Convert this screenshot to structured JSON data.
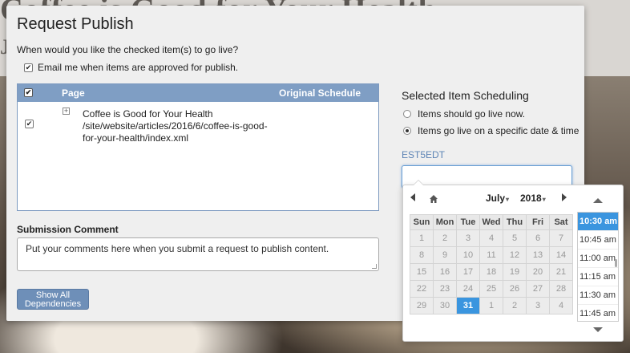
{
  "background": {
    "headline": "Coffee is Good for Your Health",
    "byline_initial": "J"
  },
  "dialog": {
    "title": "Request Publish",
    "prompt": "When would you like the checked item(s) to go live?",
    "email_label": "Email me when items are approved for publish.",
    "table": {
      "col_page": "Page",
      "col_schedule": "Original Schedule",
      "rows": [
        {
          "checked": true,
          "title": "Coffee is Good for Your Health",
          "path": "/site/website/articles/2016/6/coffee-is-good-for-your-health/index.xml",
          "schedule": ""
        }
      ]
    },
    "submission": {
      "label": "Submission Comment",
      "placeholder": "Put your comments here when you submit a request to publish content."
    },
    "dependencies_button": "Show All Dependencies",
    "scheduling": {
      "title": "Selected Item Scheduling",
      "option_now": "Items should go live now.",
      "option_specific": "Items go live on a specific date & time",
      "selected_option": "specific",
      "timezone": "EST5EDT",
      "datetime_value": ""
    },
    "picker": {
      "month": "July",
      "year": "2018",
      "weekdays": [
        "Sun",
        "Mon",
        "Tue",
        "Wed",
        "Thu",
        "Fri",
        "Sat"
      ],
      "weeks": [
        [
          "1",
          "2",
          "3",
          "4",
          "5",
          "6",
          "7"
        ],
        [
          "8",
          "9",
          "10",
          "11",
          "12",
          "13",
          "14"
        ],
        [
          "15",
          "16",
          "17",
          "18",
          "19",
          "20",
          "21"
        ],
        [
          "22",
          "23",
          "24",
          "25",
          "26",
          "27",
          "28"
        ],
        [
          "29",
          "30",
          "31",
          "1",
          "2",
          "3",
          "4"
        ]
      ],
      "selected_day": "31",
      "times": [
        "10:30 am",
        "10:45 am",
        "11:00 am",
        "11:15 am",
        "11:30 am",
        "11:45 am"
      ],
      "selected_time": "10:30 am"
    }
  },
  "colors": {
    "accent": "#3a95df",
    "table_header": "#7f9ec4",
    "button": "#6e8fb8",
    "timezone_text": "#5d84b5"
  }
}
